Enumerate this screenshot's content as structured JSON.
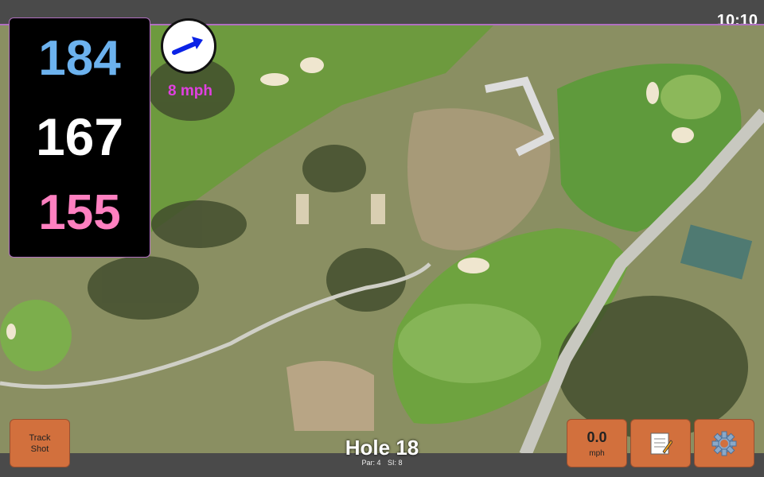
{
  "status_bar": {
    "time": "10:10"
  },
  "distances": {
    "back": "184",
    "middle": "167",
    "front": "155"
  },
  "wind": {
    "speed": "8 mph",
    "direction_icon": "wind-arrow-icon"
  },
  "hole": {
    "title": "Hole 18",
    "par": "Par: 4",
    "stroke_index": "SI: 8"
  },
  "buttons": {
    "track_shot_line1": "Track",
    "track_shot_line2": "Shot",
    "speed_value": "0.0",
    "speed_unit": "mph",
    "notes_icon": "notepad-icon",
    "settings_icon": "gear-icon"
  },
  "colors": {
    "back_distance": "#6cb2ee",
    "middle_distance": "#ffffff",
    "front_distance": "#ff80c0",
    "wind_text": "#e040e0",
    "button_bg": "#d2703d"
  }
}
